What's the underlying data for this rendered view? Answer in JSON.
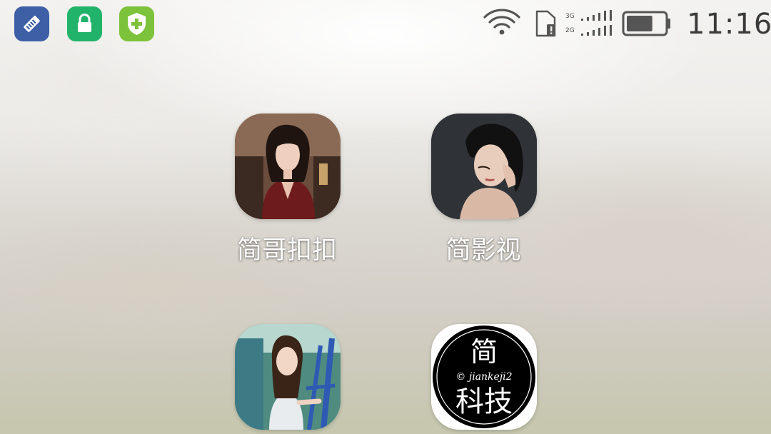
{
  "status_bar": {
    "time": "11:16",
    "notification_icons": [
      "cleaner-icon",
      "lock-icon",
      "shield-plus-icon"
    ],
    "network_labels": [
      "3G",
      "2G"
    ],
    "battery_level": 0.7
  },
  "apps": [
    {
      "label": "简哥扣扣",
      "icon": "portrait-woman-red-dress"
    },
    {
      "label": "简影视",
      "icon": "portrait-woman-black-hair"
    },
    {
      "label": "",
      "icon": "portrait-woman-outdoor"
    },
    {
      "label": "",
      "icon": "jiankeji-logo",
      "logo_text": [
        "简",
        "© jiankeji2",
        "科技"
      ]
    }
  ],
  "colors": {
    "notif_blue": "#3c5fa6",
    "notif_green": "#22b36b",
    "notif_lime": "#7cc23a",
    "label_text": "#ffffff"
  }
}
